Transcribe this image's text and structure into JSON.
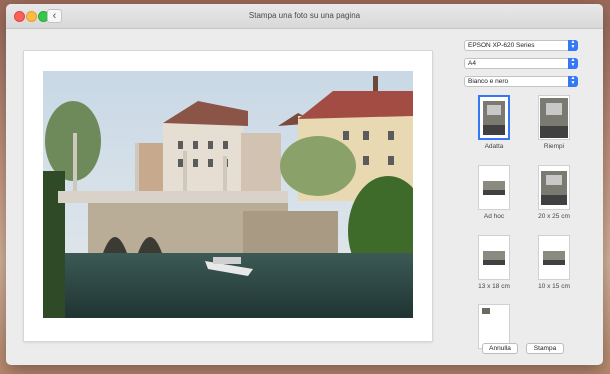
{
  "window": {
    "title": "Stampa una foto su una pagina"
  },
  "printer": {
    "selected": "EPSON XP-620 Series"
  },
  "paper_size": {
    "selected": "A4"
  },
  "color_mode": {
    "selected": "Bianco e nero"
  },
  "layouts": [
    {
      "label": "Adatta",
      "selected": true
    },
    {
      "label": "Riempi",
      "selected": false
    },
    {
      "label": "Ad hoc",
      "selected": false
    },
    {
      "label": "20 x 25 cm",
      "selected": false
    },
    {
      "label": "13 x 18 cm",
      "selected": false
    },
    {
      "label": "10 x 15 cm",
      "selected": false
    },
    {
      "label": "",
      "selected": false
    }
  ],
  "buttons": {
    "cancel": "Annulla",
    "print": "Stampa"
  },
  "icons": {
    "back": "chevron-left-icon",
    "dropdown": "chevron-updown-icon"
  },
  "colors": {
    "accent": "#3478f6",
    "close": "#fc605b",
    "minimize": "#fdbc40",
    "zoom": "#34c84a"
  }
}
